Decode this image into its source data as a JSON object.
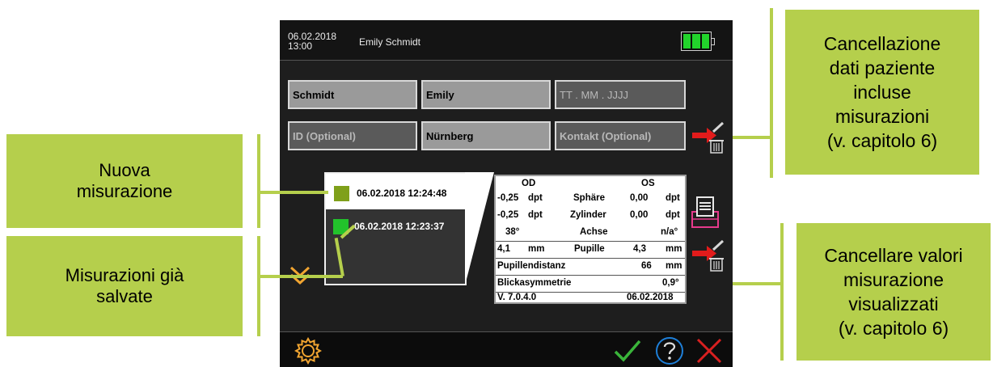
{
  "device": {
    "date": "06.02.2018",
    "time": "13:00",
    "user_name": "Emily Schmidt",
    "battery_level": 1.0,
    "form": {
      "last_name": "Schmidt",
      "first_name": "Emily",
      "birth_placeholder": "TT  .  MM  .  JJJJ",
      "id_placeholder": "ID (Optional)",
      "city": "Nürnberg",
      "contact_placeholder": "Kontakt (Optional)"
    },
    "measurements": [
      {
        "timestamp": "06.02.2018 12:24:48",
        "color": "#7fa01a"
      },
      {
        "timestamp": "06.02.2018 12:23:37",
        "color": "#22c22b"
      }
    ],
    "results": {
      "od_header": "OD",
      "os_header": "OS",
      "rows": [
        {
          "od": "-0,25",
          "od_unit": "dpt",
          "label": "Sphäre",
          "os": "0,00",
          "os_unit": "dpt"
        },
        {
          "od": "-0,25",
          "od_unit": "dpt",
          "label": "Zylinder",
          "os": "0,00",
          "os_unit": "dpt"
        },
        {
          "od": "38°",
          "od_unit": "",
          "label": "Achse",
          "os": "n/a°",
          "os_unit": ""
        },
        {
          "od": "4,1",
          "od_unit": "mm",
          "label": "Pupille",
          "os": "4,3",
          "os_unit": "mm"
        }
      ],
      "pd_label": "Pupillendistanz",
      "pd_value": "66",
      "pd_unit": "mm",
      "blick_label": "Blickasymmetrie",
      "blick_value": "0,9°",
      "version": "V. 7.0.4.0",
      "date": "06.02.2018"
    },
    "colors": {
      "accent_orange": "#f2a531",
      "battery_green": "#22d32b",
      "delete_red": "#e21b1b",
      "ok_green": "#3ab43a",
      "help_blue": "#1e7fd8",
      "cancel_red": "#d82020"
    },
    "icons": [
      "delete-patient-icon",
      "print-icon",
      "delete-measurement-icon",
      "expand-chevron-icon",
      "settings-gear-icon",
      "confirm-check-icon",
      "help-icon",
      "cancel-x-icon"
    ]
  },
  "callouts": {
    "delete_patient": [
      "Cancellazione",
      "dati paziente",
      "incluse",
      "misurazioni",
      "(v. capitolo 6)"
    ],
    "new_measurement": [
      "Nuova",
      "misurazione"
    ],
    "saved_measurements": [
      "Misurazioni già",
      "salvate"
    ],
    "delete_values": [
      "Cancellare valori",
      "misurazione",
      "visualizzati",
      "(v. capitolo 6)"
    ]
  }
}
